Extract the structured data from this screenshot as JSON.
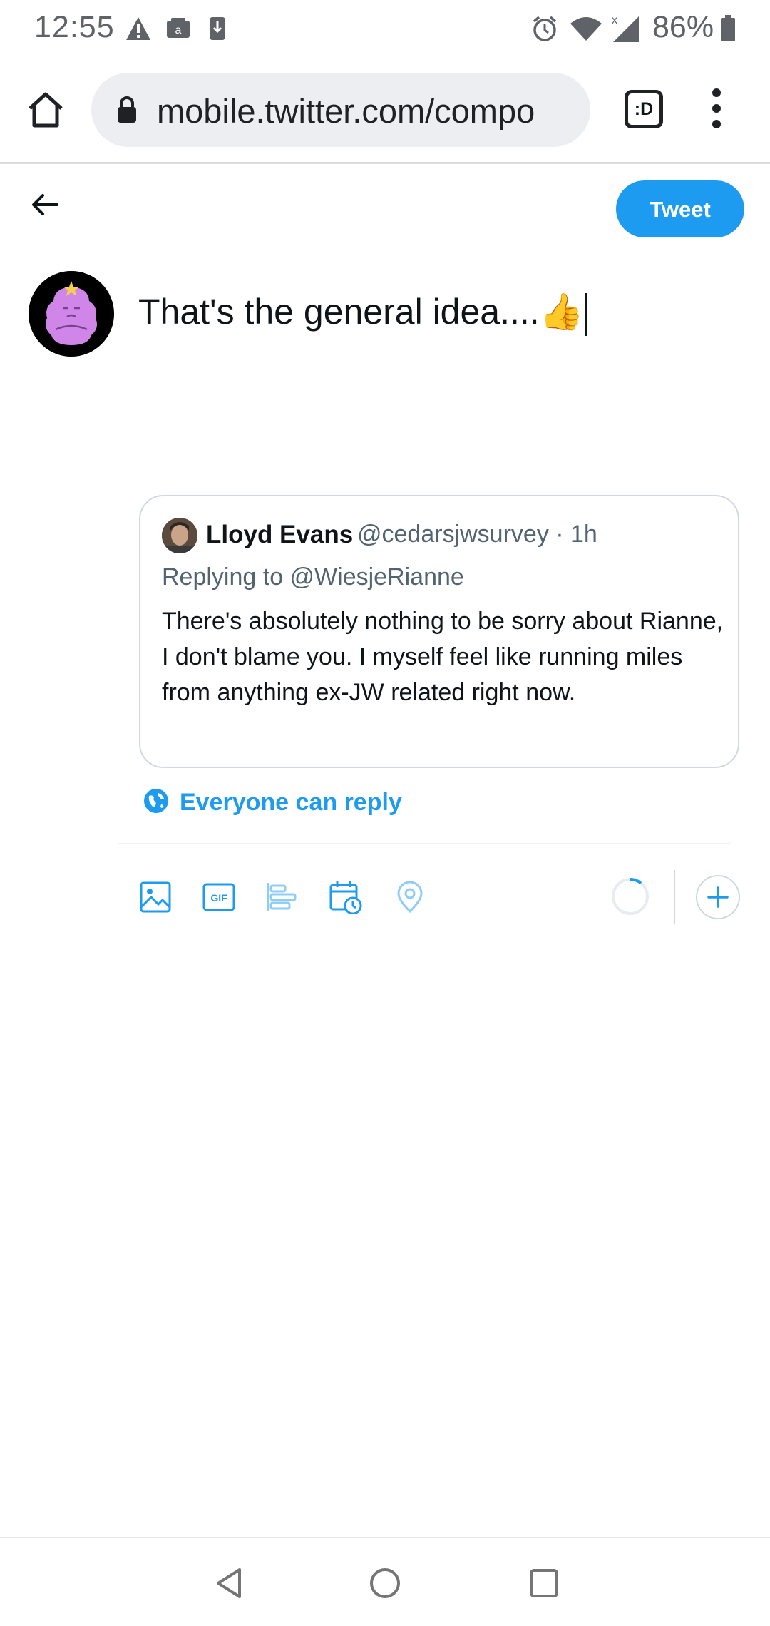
{
  "status_bar": {
    "time": "12:55",
    "battery": "86%",
    "icons": [
      "warning-icon",
      "amazon-icon",
      "download-icon",
      "alarm-icon",
      "wifi-icon",
      "signal-icon",
      "battery-icon"
    ]
  },
  "browser": {
    "url": "mobile.twitter.com/compo",
    "tab_switcher_label": ":D"
  },
  "compose": {
    "tweet_button": "Tweet",
    "text": "That's the general idea....👍"
  },
  "quoted_tweet": {
    "name": "Lloyd Evans",
    "handle_time": "@cedarsjwsurvey · 1h",
    "replying_to": "Replying to @WiesjeRianne",
    "body": "There's absolutely nothing to be sorry about Rianne, I don't blame you. I myself feel like running miles from anything ex-JW related right now."
  },
  "reply_setting": {
    "label": "Everyone can reply"
  },
  "colors": {
    "accent": "#1d9bf0",
    "text_primary": "#0f1419",
    "text_secondary": "#536471",
    "border": "#cfd9de"
  }
}
